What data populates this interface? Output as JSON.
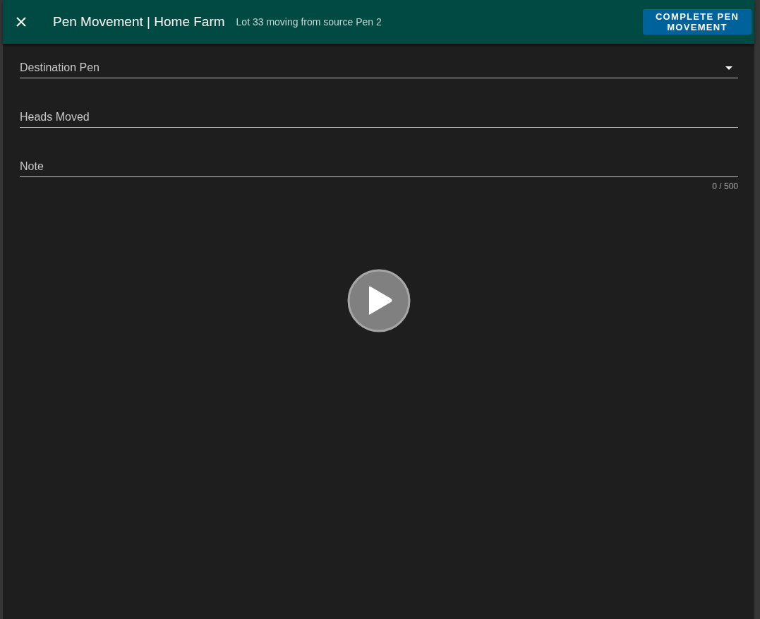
{
  "header": {
    "title": "Pen Movement | Home Farm",
    "subtitle": "Lot 33 moving from source Pen 2",
    "action_button": "COMPLETE PEN MOVEMENT"
  },
  "fields": [
    {
      "kind": "select",
      "label": "Destination Pen"
    },
    {
      "kind": "text",
      "label": "Heads Moved"
    },
    {
      "kind": "textarea",
      "label": "Note",
      "counter": "0 / 500"
    }
  ]
}
